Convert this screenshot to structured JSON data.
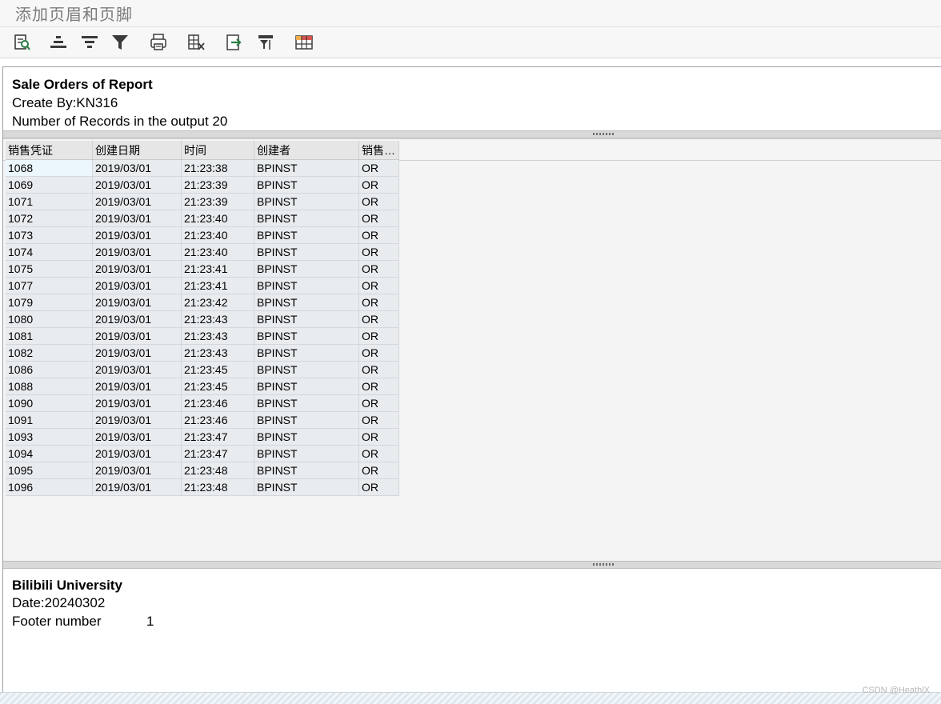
{
  "window": {
    "title": "添加页眉和页脚"
  },
  "toolbar": {
    "buttons": [
      {
        "icon": "details-icon"
      },
      {
        "icon": "sort-ascending-icon"
      },
      {
        "icon": "sort-descending-icon"
      },
      {
        "icon": "filter-icon"
      },
      {
        "icon": "print-preview-icon"
      },
      {
        "icon": "spreadsheet-export-icon"
      },
      {
        "icon": "export-icon"
      },
      {
        "icon": "select-layout-icon"
      },
      {
        "icon": "layout-grid-icon"
      }
    ]
  },
  "report_header": {
    "title": "Sale Orders of Report",
    "created_by": "Create By:KN316",
    "record_count": "Number of Records in the output  20"
  },
  "grid": {
    "columns": [
      "销售凭证",
      "创建日期",
      "时间",
      "创建者",
      "销售…"
    ],
    "rows": [
      [
        "1068",
        "2019/03/01",
        "21:23:38",
        "BPINST",
        "OR"
      ],
      [
        "1069",
        "2019/03/01",
        "21:23:39",
        "BPINST",
        "OR"
      ],
      [
        "1071",
        "2019/03/01",
        "21:23:39",
        "BPINST",
        "OR"
      ],
      [
        "1072",
        "2019/03/01",
        "21:23:40",
        "BPINST",
        "OR"
      ],
      [
        "1073",
        "2019/03/01",
        "21:23:40",
        "BPINST",
        "OR"
      ],
      [
        "1074",
        "2019/03/01",
        "21:23:40",
        "BPINST",
        "OR"
      ],
      [
        "1075",
        "2019/03/01",
        "21:23:41",
        "BPINST",
        "OR"
      ],
      [
        "1077",
        "2019/03/01",
        "21:23:41",
        "BPINST",
        "OR"
      ],
      [
        "1079",
        "2019/03/01",
        "21:23:42",
        "BPINST",
        "OR"
      ],
      [
        "1080",
        "2019/03/01",
        "21:23:43",
        "BPINST",
        "OR"
      ],
      [
        "1081",
        "2019/03/01",
        "21:23:43",
        "BPINST",
        "OR"
      ],
      [
        "1082",
        "2019/03/01",
        "21:23:43",
        "BPINST",
        "OR"
      ],
      [
        "1086",
        "2019/03/01",
        "21:23:45",
        "BPINST",
        "OR"
      ],
      [
        "1088",
        "2019/03/01",
        "21:23:45",
        "BPINST",
        "OR"
      ],
      [
        "1090",
        "2019/03/01",
        "21:23:46",
        "BPINST",
        "OR"
      ],
      [
        "1091",
        "2019/03/01",
        "21:23:46",
        "BPINST",
        "OR"
      ],
      [
        "1093",
        "2019/03/01",
        "21:23:47",
        "BPINST",
        "OR"
      ],
      [
        "1094",
        "2019/03/01",
        "21:23:47",
        "BPINST",
        "OR"
      ],
      [
        "1095",
        "2019/03/01",
        "21:23:48",
        "BPINST",
        "OR"
      ],
      [
        "1096",
        "2019/03/01",
        "21:23:48",
        "BPINST",
        "OR"
      ]
    ]
  },
  "report_footer": {
    "title": "Bilibili University",
    "date": "Date:20240302",
    "footer_label": "Footer number",
    "footer_value": "1"
  },
  "watermark": "CSDN @HeathlX"
}
